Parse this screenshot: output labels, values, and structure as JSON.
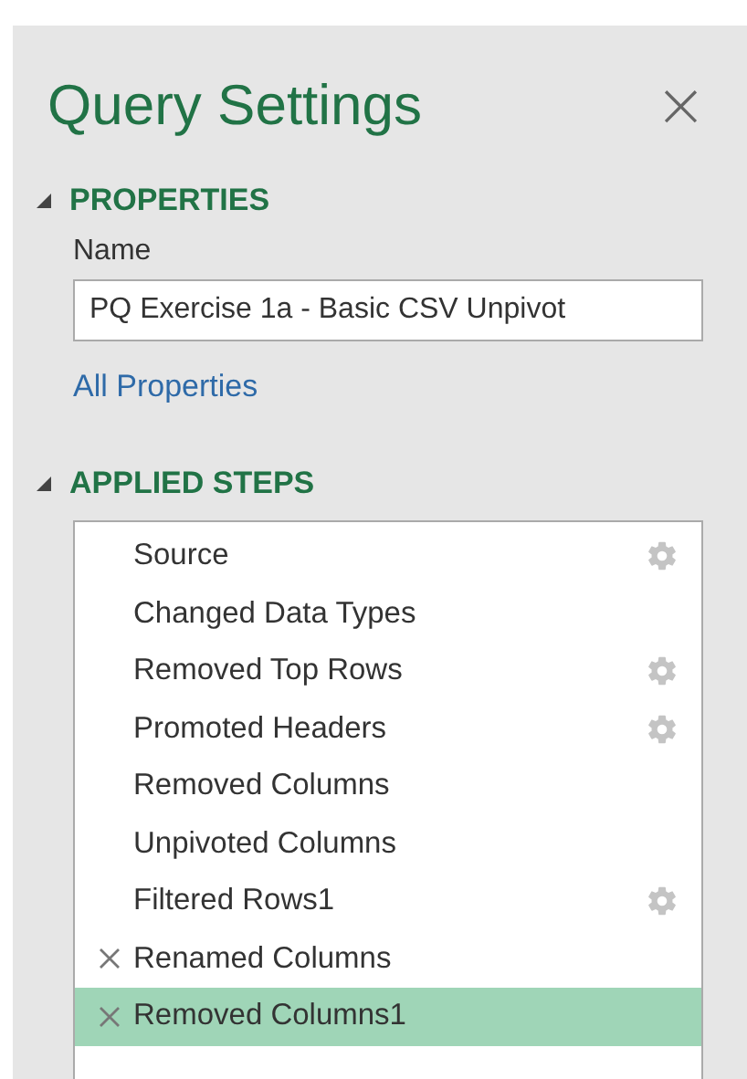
{
  "panel": {
    "title": "Query Settings",
    "close": "×"
  },
  "properties": {
    "heading": "PROPERTIES",
    "expanded": true,
    "name_label": "Name",
    "name_value": "PQ Exercise 1a - Basic CSV Unpivot",
    "link": "All Properties"
  },
  "applied_steps": {
    "heading": "APPLIED STEPS",
    "expanded": true,
    "steps": [
      {
        "label": "Source",
        "gear": true,
        "delete": false,
        "selected": false
      },
      {
        "label": "Changed Data Types",
        "gear": false,
        "delete": false,
        "selected": false
      },
      {
        "label": "Removed Top Rows",
        "gear": true,
        "delete": false,
        "selected": false
      },
      {
        "label": "Promoted Headers",
        "gear": true,
        "delete": false,
        "selected": false
      },
      {
        "label": "Removed Columns",
        "gear": false,
        "delete": false,
        "selected": false
      },
      {
        "label": "Unpivoted Columns",
        "gear": false,
        "delete": false,
        "selected": false
      },
      {
        "label": "Filtered Rows1",
        "gear": true,
        "delete": false,
        "selected": false
      },
      {
        "label": "Renamed Columns",
        "gear": false,
        "delete": true,
        "selected": false
      },
      {
        "label": "Removed Columns1",
        "gear": false,
        "delete": true,
        "selected": true
      }
    ]
  }
}
